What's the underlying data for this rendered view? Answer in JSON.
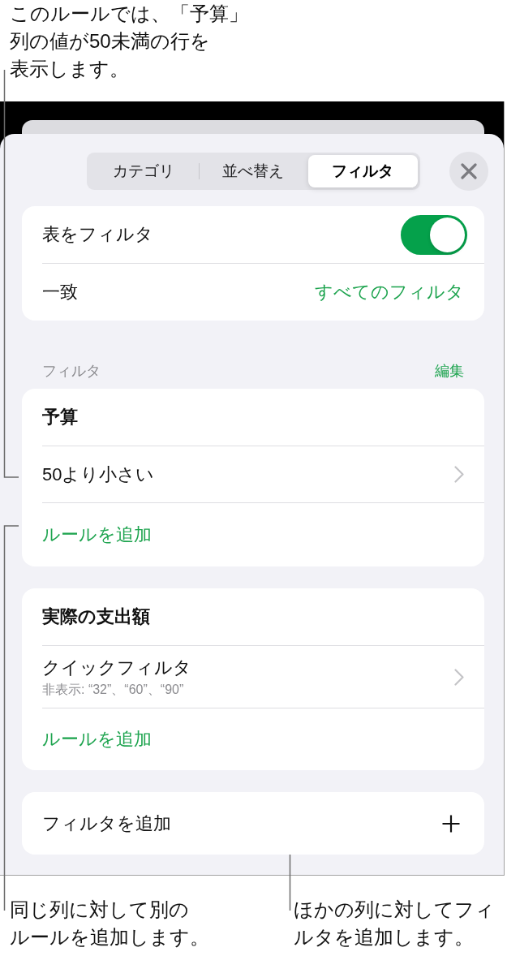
{
  "top_callout": "このルールでは、「予算」列の値が50未満の行を表示します。",
  "sheet": {
    "tabs": [
      {
        "label": "カテゴリ",
        "selected": false
      },
      {
        "label": "並べ替え",
        "selected": false
      },
      {
        "label": "フィルタ",
        "selected": true
      }
    ],
    "settings": [
      {
        "kind": "toggle",
        "label": "表をフィルタ",
        "on": true
      },
      {
        "kind": "choice",
        "label": "一致",
        "value": "すべてのフィルタ"
      }
    ],
    "filters_section": {
      "title": "フィルタ",
      "action": "編集"
    },
    "filters": [
      {
        "column": "予算",
        "rules": [
          {
            "label": "50より小さい"
          }
        ],
        "add_rule": "ルールを追加"
      },
      {
        "column": "実際の支出額",
        "rules": [
          {
            "label": "クイックフィルタ",
            "detail": "非表示: “32”、“60”、“90”"
          }
        ],
        "add_rule": "ルールを追加"
      }
    ],
    "add_filter": "フィルタを追加"
  },
  "bottom_callouts": [
    "同じ列に対して別のルールを追加します。",
    "ほかの列に対してフィルタを追加します。"
  ]
}
